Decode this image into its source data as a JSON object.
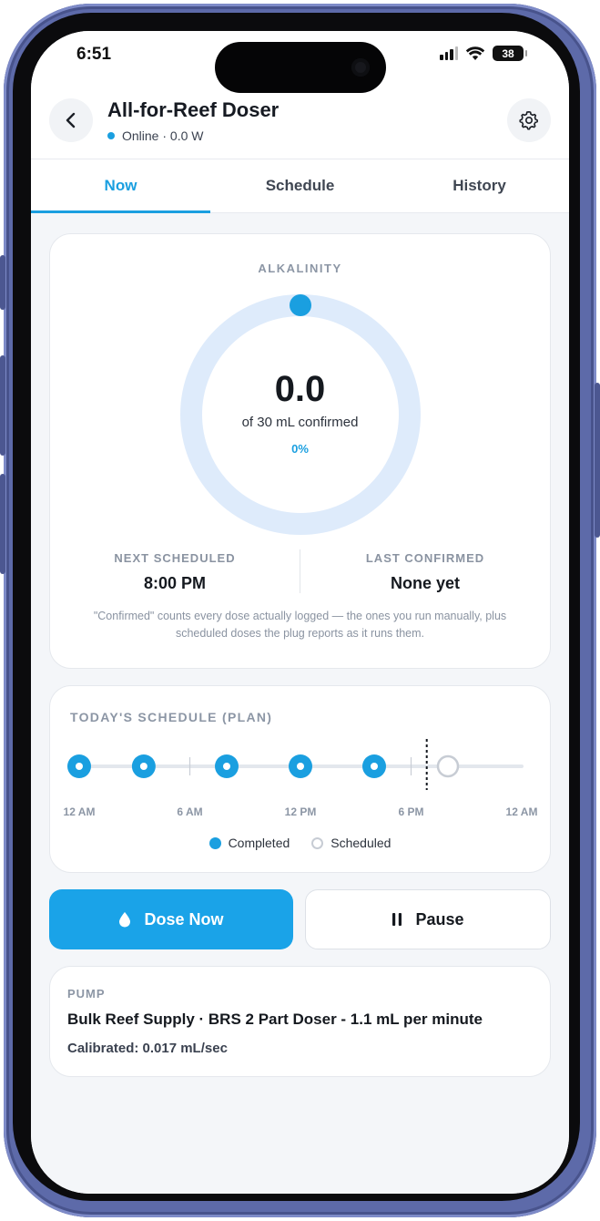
{
  "status_bar": {
    "time": "6:51",
    "battery": "38"
  },
  "header": {
    "title": "All-for-Reef Doser",
    "status": "Online · 0.0 W",
    "online_color": "#1a9fe0"
  },
  "tabs": [
    {
      "label": "Now",
      "active": true
    },
    {
      "label": "Schedule",
      "active": false
    },
    {
      "label": "History",
      "active": false
    }
  ],
  "dose_summary": {
    "label": "ALKALINITY",
    "value": "0.0",
    "subtitle": "of 30 mL confirmed",
    "percent_text": "0%",
    "progress": 0,
    "next_scheduled_title": "NEXT SCHEDULED",
    "next_scheduled_value": "8:00 PM",
    "last_confirmed_title": "LAST CONFIRMED",
    "last_confirmed_value": "None yet",
    "footnote": "\"Confirmed\" counts every dose actually logged — the ones you run manually, plus scheduled doses the plug reports as it runs them."
  },
  "schedule": {
    "title": "TODAY'S SCHEDULE (PLAN)",
    "axis_labels": [
      "12 AM",
      "6 AM",
      "12 PM",
      "6 PM",
      "12 AM"
    ],
    "doses": [
      {
        "hour": 0,
        "status": "completed"
      },
      {
        "hour": 3.5,
        "status": "completed"
      },
      {
        "hour": 8,
        "status": "completed"
      },
      {
        "hour": 12,
        "status": "completed"
      },
      {
        "hour": 16,
        "status": "completed"
      },
      {
        "hour": 20,
        "status": "scheduled"
      }
    ],
    "now_hour": 18.85,
    "legend_completed": "Completed",
    "legend_scheduled": "Scheduled"
  },
  "actions": {
    "dose_label": "Dose Now",
    "pause_label": "Pause"
  },
  "pump": {
    "label": "PUMP",
    "name": "Bulk Reef Supply · BRS 2 Part Doser - 1.1 mL per minute",
    "calibration": "Calibrated: 0.017 mL/sec"
  },
  "colors": {
    "accent": "#1a9fe0",
    "ring_track": "#deebfb"
  }
}
